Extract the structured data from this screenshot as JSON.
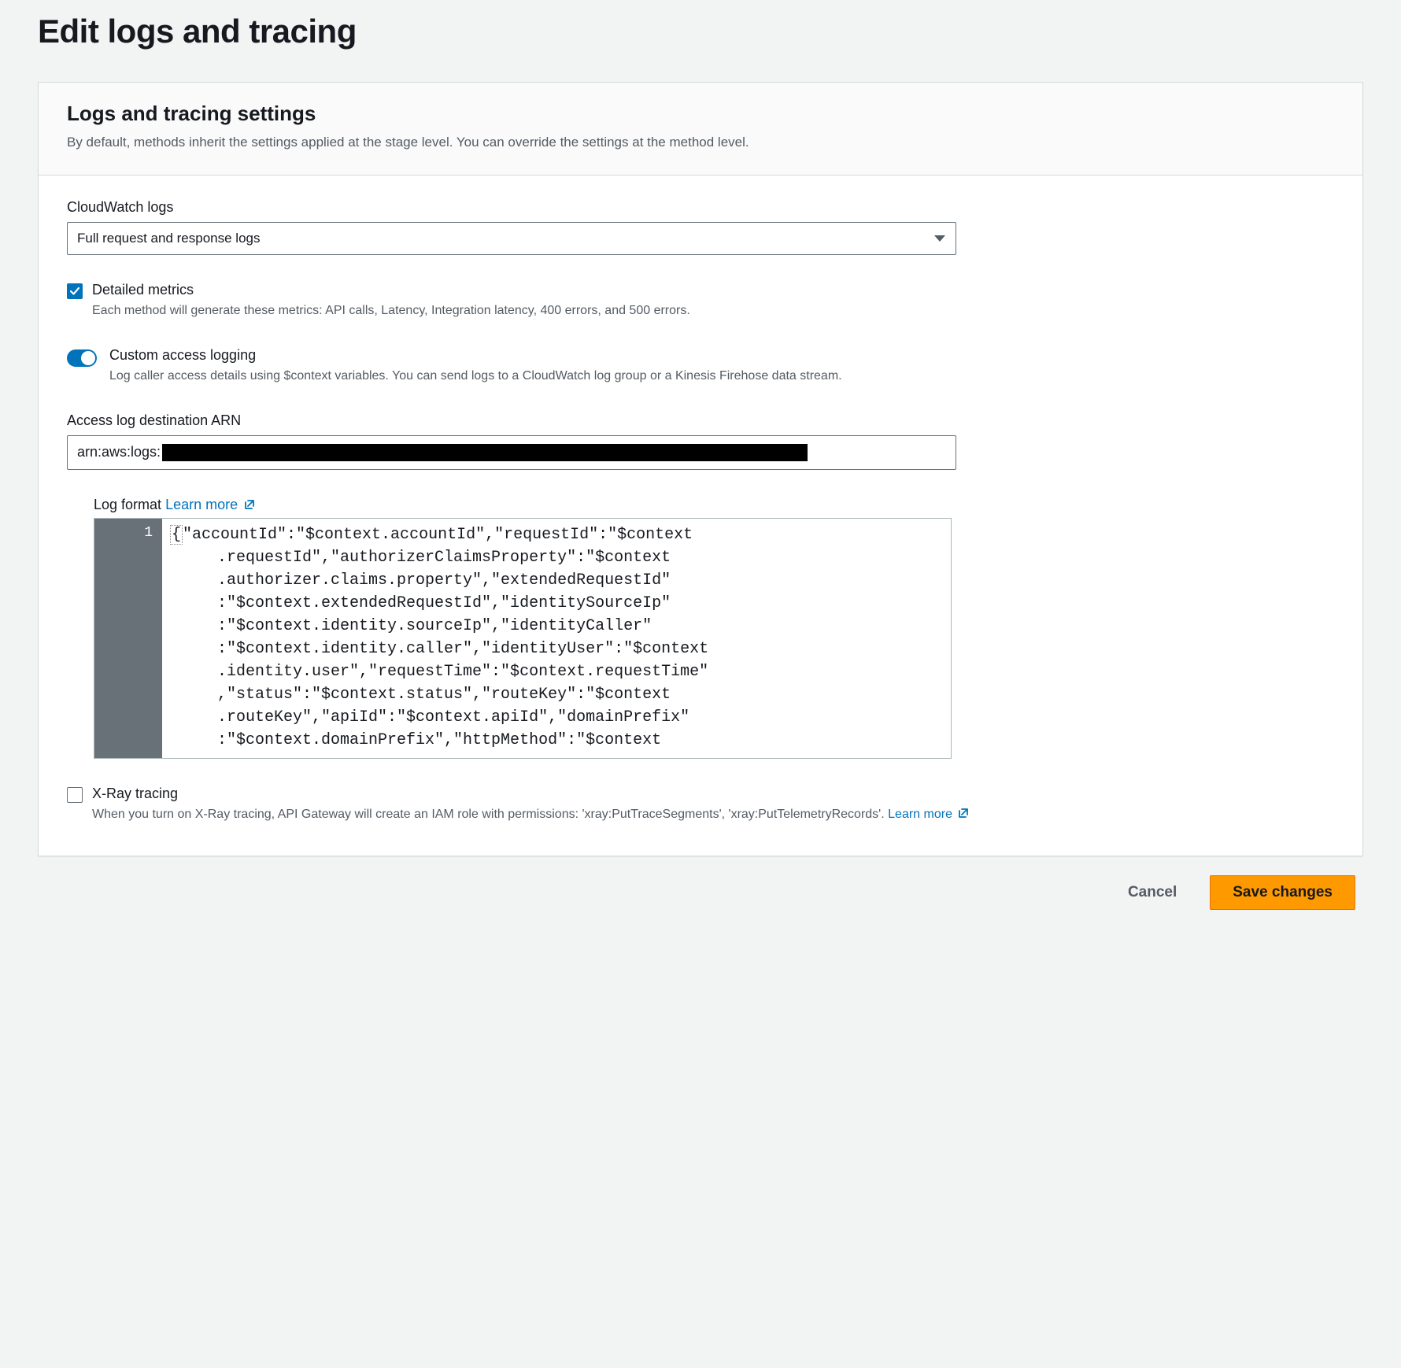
{
  "page": {
    "title": "Edit logs and tracing"
  },
  "panel": {
    "title": "Logs and tracing settings",
    "description": "By default, methods inherit the settings applied at the stage level. You can override the settings at the method level."
  },
  "cloudwatch": {
    "label": "CloudWatch logs",
    "selected": "Full request and response logs"
  },
  "detailed_metrics": {
    "label": "Detailed metrics",
    "description": "Each method will generate these metrics: API calls, Latency, Integration latency, 400 errors, and 500 errors.",
    "checked": true
  },
  "custom_access": {
    "label": "Custom access logging",
    "description": "Log caller access details using $context variables. You can send logs to a CloudWatch log group or a Kinesis Firehose data stream.",
    "enabled": true
  },
  "arn": {
    "label": "Access log destination ARN",
    "prefix": "arn:aws:logs:"
  },
  "log_format": {
    "label": "Log format",
    "learn_more": "Learn more",
    "line_number": "1",
    "code": "{\"accountId\":\"$context.accountId\",\"requestId\":\"$context.requestId\",\"authorizerClaimsProperty\":\"$context.authorizer.claims.property\",\"extendedRequestId\":\"$context.extendedRequestId\",\"identitySourceIp\":\"$context.identity.sourceIp\",\"identityCaller\":\"$context.identity.caller\",\"identityUser\":\"$context.identity.user\",\"requestTime\":\"$context.requestTime\",\"status\":\"$context.status\",\"routeKey\":\"$context.routeKey\",\"apiId\":\"$context.apiId\",\"domainPrefix\":\"$context.domainPrefix\",\"httpMethod\":\"$context"
  },
  "xray": {
    "label": "X-Ray tracing",
    "description": "When you turn on X-Ray tracing, API Gateway will create an IAM role with permissions: 'xray:PutTraceSegments', 'xray:PutTelemetryRecords'.",
    "learn_more": "Learn more",
    "checked": false
  },
  "actions": {
    "cancel": "Cancel",
    "save": "Save changes"
  }
}
